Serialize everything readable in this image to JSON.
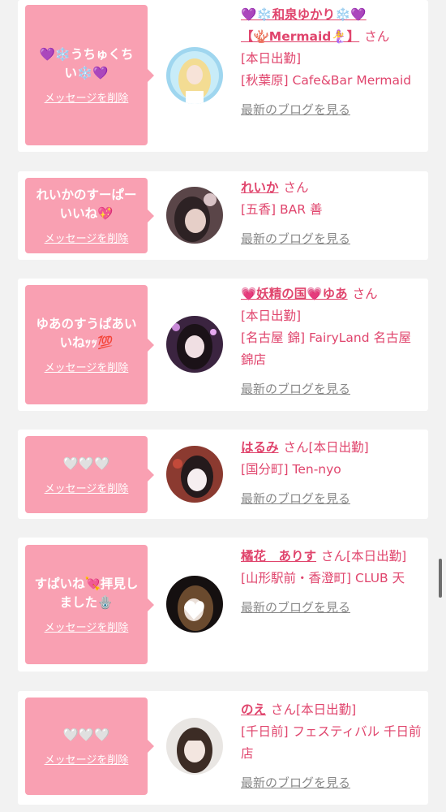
{
  "delete_label": "メッセージを削除",
  "blog_label": "最新のブログを見る",
  "san_label": "さん",
  "entries": [
    {
      "message": "💜❄️うちゅくちい❄️💜",
      "name_line1": "💜❄️和泉ゆかり❄️💜",
      "name_line2": "【🪸Mermaid🧜‍♀️】",
      "status": "[本日出勤]",
      "shop": "[秋葉原] Cafe&Bar Mermaid"
    },
    {
      "message": "れいかのすーぱーいいね💖",
      "name": "れいか",
      "shop": "[五香] BAR 善"
    },
    {
      "message": "ゆあのすうぱあいいねｯｯ💯",
      "name": "💗妖精の国💗ゆあ",
      "status": "[本日出勤]",
      "shop": "[名古屋 錦] FairyLand 名古屋錦店"
    },
    {
      "message": "🤍🤍🤍",
      "name": "はるみ",
      "status": "[本日出勤]",
      "shop": "[国分町] Ten-nyo"
    },
    {
      "message": "すぱいね💘拝見しました🪬",
      "name": "橘花　ありす",
      "status": "[本日出勤]",
      "shop": "[山形駅前・香澄町] CLUB 天"
    },
    {
      "message": "🤍🤍🤍",
      "name": "のえ",
      "status": "[本日出勤]",
      "shop": "[千日前] フェスティバル 千日前店"
    }
  ]
}
